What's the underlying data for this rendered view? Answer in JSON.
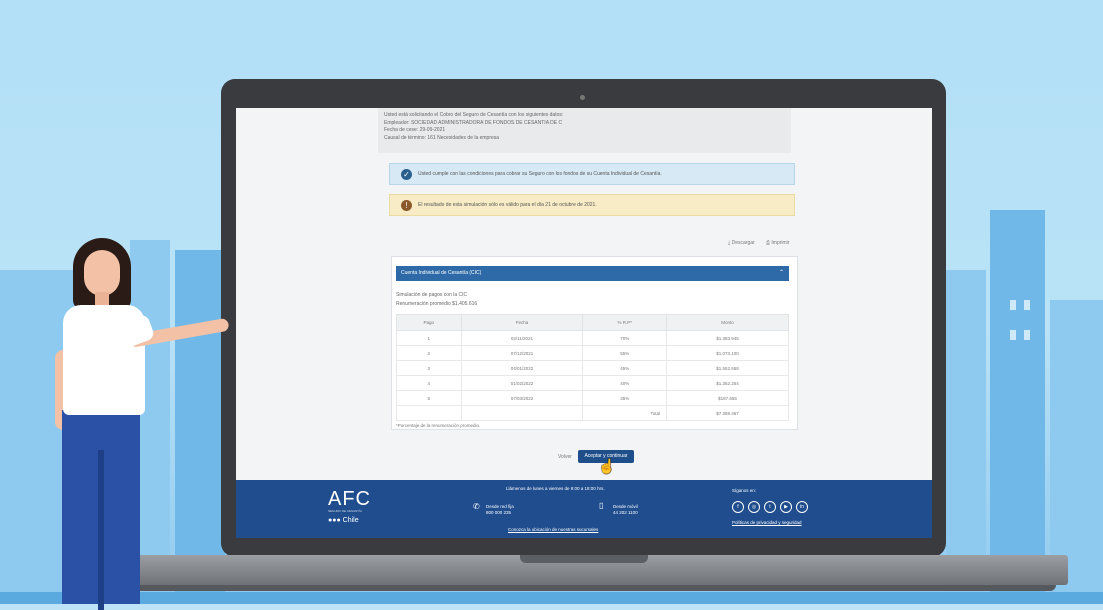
{
  "summary": {
    "lines": [
      "Usted está solicitando el Cobro del Seguro de Cesantía con los siguientes datos:",
      "Empleador: SOCIEDAD ADMINISTRADORA DE FONDOS DE CESANTIA DE C",
      "Fecha de cese: 29-09-2021",
      "Causal de término: 161 Necesidades de la empresa"
    ]
  },
  "alerts": {
    "ok": "Usted cumple con las condiciones para cobrar su Seguro con los fondos de su Cuenta Individual de Cesantía.",
    "warn": "El resultado de esta simulación sólo es válido para el día 21 de octubre de 2021."
  },
  "actions": {
    "download": "Descargar",
    "print": "Imprimir"
  },
  "panel": {
    "title": "Cuenta Individual de Cesantía (CIC)",
    "sim_label": "Simulación de pagos con la CIC",
    "remuneration": "Renumeración promedio $1.405.616",
    "headers": [
      "Pago",
      "Fecha",
      "% R.P*",
      "Monto"
    ],
    "rows": [
      [
        "1",
        "02/11/2021",
        "70%",
        "$1.383.945"
      ],
      [
        "2",
        "07/12/2021",
        "55%",
        "$1.073.100"
      ],
      [
        "3",
        "04/01/2022",
        "45%",
        "$1.552.558"
      ],
      [
        "4",
        "01/02/2022",
        "40%",
        "$1.362.254"
      ],
      [
        "5",
        "07/03/2022",
        "35%",
        "$187.655"
      ]
    ],
    "total_label": "Total",
    "total_value": "$7.359.367",
    "footnote": "*Porcentaje de la renumeración promedio."
  },
  "buttons": {
    "cancel": "Volver",
    "accept": "Aceptar y continuar"
  },
  "footer": {
    "logo": "AFC",
    "logo_sub": "SEGURO DE CESANTÍA",
    "logo_country": "Chile",
    "hours": "Llámenos de lunes a viernes de 9:00 a 18:00 hrs.",
    "landline_label": "Desde red fija",
    "landline_number": "800 000 235",
    "mobile_label": "Desde móvil",
    "mobile_number": "44 202 1100",
    "branches_link": "Conozca la ubicación de nuestras sucursales",
    "follow": "Síganos en:",
    "social": [
      "f",
      "◎",
      "t",
      "▶",
      "in"
    ],
    "privacy_link": "Políticas de privacidad y seguridad"
  },
  "colors": {
    "brand_blue": "#1f4d8e",
    "panel_header": "#2e6aa7",
    "accept": "#1f4f8a"
  }
}
